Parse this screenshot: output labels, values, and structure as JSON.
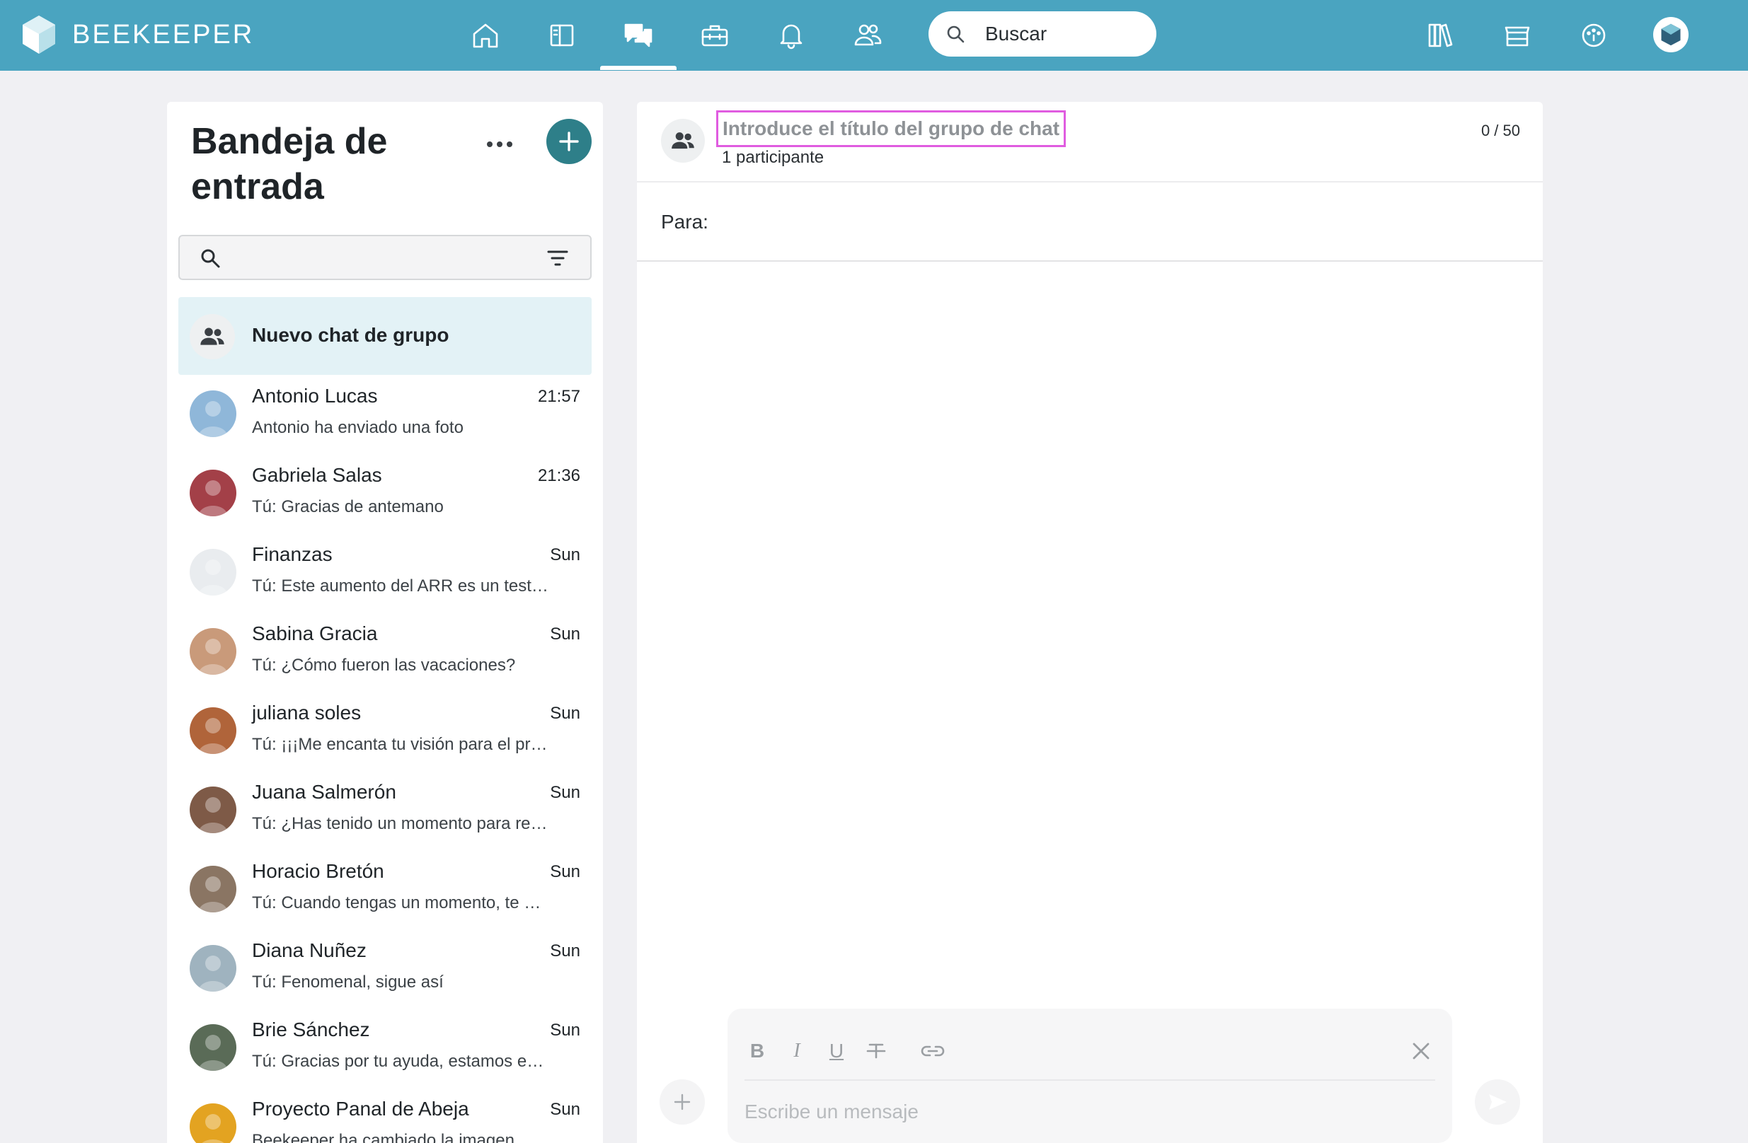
{
  "app": {
    "brand": "BEEKEEPER",
    "accent_color": "#4aa4c0",
    "primary_button_color": "#2e7f89"
  },
  "topbar": {
    "nav_icons": [
      "home-icon",
      "news-icon",
      "chat-icon",
      "toolbox-icon",
      "bell-icon",
      "people-icon"
    ],
    "active_nav": "chat-icon",
    "search_placeholder": "Buscar",
    "right_icons": [
      "library-icon",
      "store-icon",
      "dashboard-icon",
      "profile-avatar"
    ]
  },
  "inbox": {
    "title": "Bandeja de entrada",
    "new_group_label": "Nuevo chat de grupo",
    "chats": [
      {
        "name": "Antonio Lucas",
        "time": "21:57",
        "preview": "Antonio ha enviado una foto",
        "avatar_color": "#8fb7d9"
      },
      {
        "name": "Gabriela Salas",
        "time": "21:36",
        "preview": "Tú: Gracias de antemano",
        "avatar_color": "#a34048"
      },
      {
        "name": "Finanzas",
        "time": "Sun",
        "preview": "Tú: Este aumento del ARR es un testimonio",
        "avatar_color": "#e9ecef"
      },
      {
        "name": "Sabina Gracia",
        "time": "Sun",
        "preview": "Tú: ¿Cómo fueron las vacaciones?",
        "avatar_color": "#c99a7a"
      },
      {
        "name": "juliana soles",
        "time": "Sun",
        "preview": "Tú: ¡¡¡Me encanta tu visión para el proyecto",
        "avatar_color": "#b0643a"
      },
      {
        "name": "Juana Salmerón",
        "time": "Sun",
        "preview": "Tú: ¿Has tenido un momento para revisar",
        "avatar_color": "#7e5a47"
      },
      {
        "name": "Horacio Bretón",
        "time": "Sun",
        "preview": "Tú: Cuando tengas un momento, te agradecería",
        "avatar_color": "#8a7563"
      },
      {
        "name": "Diana Nuñez",
        "time": "Sun",
        "preview": "Tú: Fenomenal, sigue así",
        "avatar_color": "#9fb3bf"
      },
      {
        "name": "Brie Sánchez",
        "time": "Sun",
        "preview": "Tú: Gracias por tu ayuda, estamos encantados",
        "avatar_color": "#5a6b57"
      },
      {
        "name": "Proyecto Panal de Abeja",
        "time": "Sun",
        "preview": "Beekeeper ha cambiado la imagen",
        "avatar_color": "#e3a321"
      }
    ]
  },
  "chat_panel": {
    "title_placeholder": "Introduce el título del grupo de chat",
    "participants": "1 participante",
    "char_counter": "0 / 50",
    "to_label": "Para:",
    "composer": {
      "placeholder": "Escribe un mensaje",
      "bold_label": "B",
      "italic_label": "I",
      "underline_label": "U"
    }
  }
}
